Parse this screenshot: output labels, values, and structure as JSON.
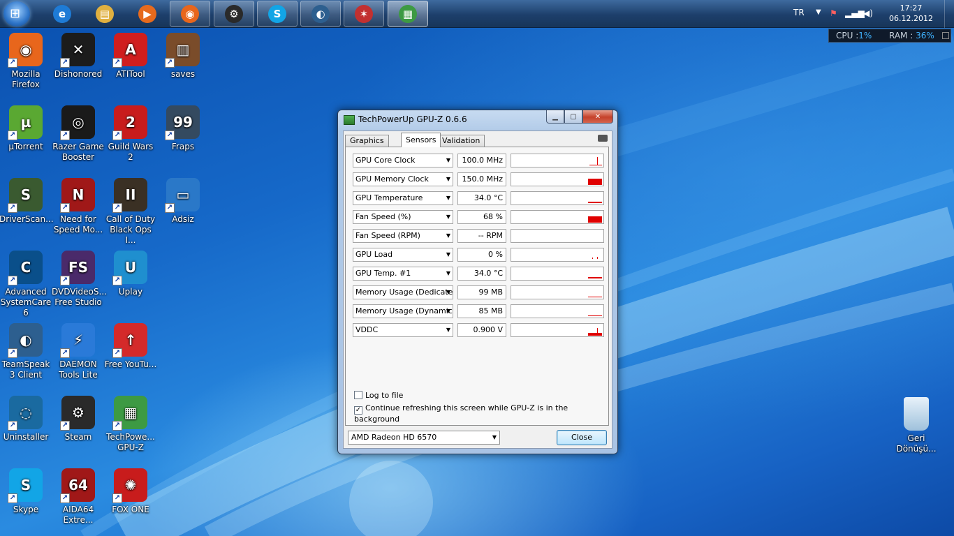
{
  "taskbar": {
    "pinned": [
      {
        "name": "ie",
        "glyph": "e",
        "color": "#1e7bd6",
        "state": "pinned"
      },
      {
        "name": "explorer",
        "glyph": "▤",
        "color": "#e0b040",
        "state": "pinned"
      },
      {
        "name": "media-player",
        "glyph": "▶",
        "color": "#e66a1d",
        "state": "pinned"
      },
      {
        "name": "firefox",
        "glyph": "◉",
        "color": "#e8661c",
        "state": "running"
      },
      {
        "name": "steam",
        "glyph": "⚙",
        "color": "#2a2a2a",
        "state": "running"
      },
      {
        "name": "skype",
        "glyph": "S",
        "color": "#12a5e6",
        "state": "running"
      },
      {
        "name": "teamspeak",
        "glyph": "◐",
        "color": "#2d5f8f",
        "state": "running"
      },
      {
        "name": "atitool",
        "glyph": "✶",
        "color": "#c23030",
        "state": "running"
      },
      {
        "name": "gpu-z",
        "glyph": "▦",
        "color": "#3d9a43",
        "state": "active"
      }
    ],
    "tray": {
      "language": "TR",
      "time": "17:27",
      "date": "06.12.2012"
    }
  },
  "meter": {
    "cpu_label": "CPU :",
    "cpu_value": "1%",
    "ram_label": "RAM :",
    "ram_value": "36%"
  },
  "desktop_icons": [
    {
      "label": "Mozilla Firefox",
      "color": "#e8661c",
      "glyph": "◉",
      "col": 0,
      "row": 0
    },
    {
      "label": "Dishonored",
      "color": "#1c1c1c",
      "glyph": "✕",
      "col": 1,
      "row": 0
    },
    {
      "label": "ATITool",
      "color": "#d01e1e",
      "glyph": "A",
      "col": 2,
      "row": 0
    },
    {
      "label": "saves",
      "color": "#7a4c2a",
      "glyph": "▥",
      "col": 3,
      "row": 0
    },
    {
      "label": "µTorrent",
      "color": "#5aa832",
      "glyph": "µ",
      "col": 0,
      "row": 1
    },
    {
      "label": "Razer Game Booster",
      "color": "#1a1a1a",
      "glyph": "◎",
      "col": 1,
      "row": 1
    },
    {
      "label": "Guild Wars 2",
      "color": "#c81c1c",
      "glyph": "2",
      "col": 2,
      "row": 1
    },
    {
      "label": "Fraps",
      "color": "#344a60",
      "glyph": "99",
      "col": 3,
      "row": 1
    },
    {
      "label": "DriverScan...",
      "color": "#3a5a30",
      "glyph": "S",
      "col": 0,
      "row": 2
    },
    {
      "label": "Need for Speed Mo...",
      "color": "#a01818",
      "glyph": "N",
      "col": 1,
      "row": 2
    },
    {
      "label": "Call of Duty Black Ops I...",
      "color": "#3a3024",
      "glyph": "II",
      "col": 2,
      "row": 2
    },
    {
      "label": "Adsiz",
      "color": "#2a78c8",
      "glyph": "▭",
      "col": 3,
      "row": 2
    },
    {
      "label": "Advanced SystemCare 6",
      "color": "#0a4f8a",
      "glyph": "C",
      "col": 0,
      "row": 3
    },
    {
      "label": "DVDVideoS... Free Studio",
      "color": "#4a2a6a",
      "glyph": "FS",
      "col": 1,
      "row": 3
    },
    {
      "label": "Uplay",
      "color": "#1f8fcf",
      "glyph": "U",
      "col": 2,
      "row": 3
    },
    {
      "label": "TeamSpeak 3 Client",
      "color": "#2d5f8f",
      "glyph": "◐",
      "col": 0,
      "row": 4
    },
    {
      "label": "DAEMON Tools Lite",
      "color": "#2a7ad8",
      "glyph": "⚡",
      "col": 1,
      "row": 4
    },
    {
      "label": "Free YouTu...",
      "color": "#d42a2a",
      "glyph": "↑",
      "col": 2,
      "row": 4
    },
    {
      "label": "Uninstaller",
      "color": "#1a6aa0",
      "glyph": "◌",
      "col": 0,
      "row": 5
    },
    {
      "label": "Steam",
      "color": "#2a2a2a",
      "glyph": "⚙",
      "col": 1,
      "row": 5
    },
    {
      "label": "TechPowe... GPU-Z",
      "color": "#3d9a43",
      "glyph": "▦",
      "col": 2,
      "row": 5
    },
    {
      "label": "Skype",
      "color": "#12a5e6",
      "glyph": "S",
      "col": 0,
      "row": 6
    },
    {
      "label": "AIDA64 Extre...",
      "color": "#a01818",
      "glyph": "64",
      "col": 1,
      "row": 6
    },
    {
      "label": "FOX ONE",
      "color": "#c81c1c",
      "glyph": "✺",
      "col": 2,
      "row": 6
    }
  ],
  "recycle_bin": {
    "label": "Geri Dönüşü..."
  },
  "window": {
    "title": "TechPowerUp GPU-Z 0.6.6",
    "tabs": [
      "Graphics Card",
      "Sensors",
      "Validation"
    ],
    "selected_tab": 1,
    "sensors": [
      {
        "name": "GPU Core Clock",
        "value": "100.0 MHz",
        "graph": "spike"
      },
      {
        "name": "GPU Memory Clock",
        "value": "150.0 MHz",
        "graph": "block"
      },
      {
        "name": "GPU Temperature",
        "value": "34.0 °C",
        "graph": "line"
      },
      {
        "name": "Fan Speed (%)",
        "value": "68 %",
        "graph": "block"
      },
      {
        "name": "Fan Speed (RPM)",
        "value": "-- RPM",
        "graph": "none"
      },
      {
        "name": "GPU Load",
        "value": "0 %",
        "graph": "dots"
      },
      {
        "name": "GPU Temp. #1",
        "value": "34.0 °C",
        "graph": "line"
      },
      {
        "name": "Memory Usage (Dedicated)",
        "value": "99 MB",
        "graph": "thin"
      },
      {
        "name": "Memory Usage (Dynamic)",
        "value": "85 MB",
        "graph": "thin"
      },
      {
        "name": "VDDC",
        "value": "0.900 V",
        "graph": "spikeblock"
      }
    ],
    "log_to_file": {
      "label": "Log to file",
      "checked": false
    },
    "continue_refresh": {
      "label": "Continue refreshing this screen while GPU-Z is in the background",
      "checked": true
    },
    "device": "AMD Radeon HD 6570",
    "close_label": "Close"
  }
}
